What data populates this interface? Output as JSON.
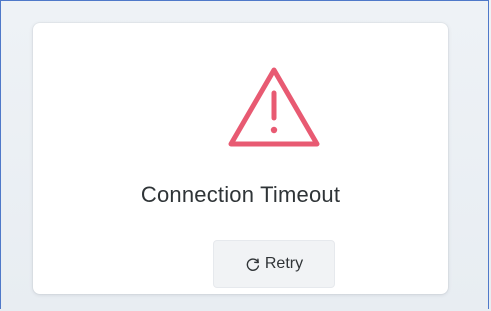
{
  "colors": {
    "warning": "#e85a72",
    "text": "#2f3437",
    "button_bg": "#f1f3f5",
    "frame": "#4f79c9"
  },
  "status": {
    "icon": "warning-triangle-icon",
    "title": "Connection Timeout"
  },
  "actions": {
    "retry_label": "Retry",
    "retry_icon": "refresh-icon"
  }
}
